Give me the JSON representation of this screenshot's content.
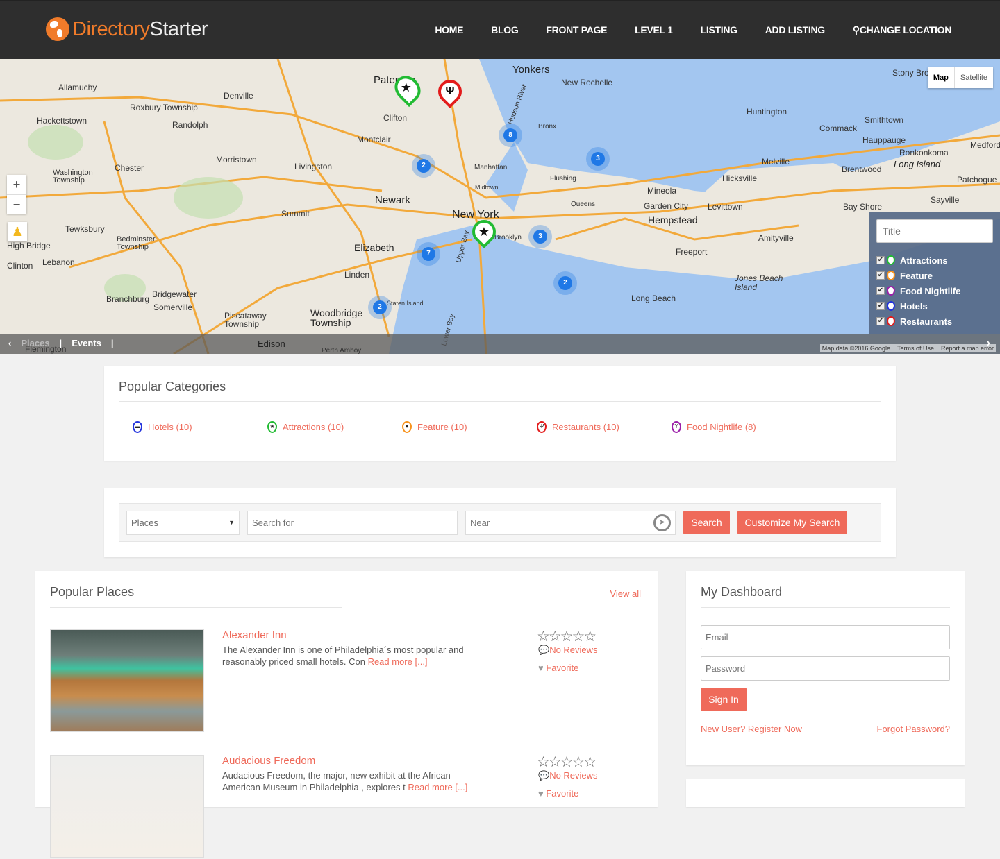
{
  "brand": {
    "name_a": "Directory",
    "name_b": "Starter"
  },
  "nav": [
    "HOME",
    "BLOG",
    "FRONT PAGE",
    "LEVEL 1",
    "LISTING",
    "ADD LISTING",
    "CHANGE LOCATION"
  ],
  "map": {
    "type_buttons": [
      "Map",
      "Satellite"
    ],
    "zoom_in": "+",
    "zoom_out": "−",
    "labels": [
      "Allamuchy",
      "Denville",
      "Paterson",
      "Yonkers",
      "New Rochelle",
      "Huntington",
      "Smithtown",
      "Stony Brook",
      "Clifton",
      "Hackettstown",
      "Roxbury Township",
      "Randolph",
      "Montclair",
      "Commack",
      "Hauppauge",
      "Ronkonkoma",
      "Medford",
      "Morristown",
      "Livingston",
      "Manhattan",
      "Bronx",
      "Melville",
      "Long Island",
      "Brentwood",
      "Patchogue",
      "Washington Township",
      "Chester",
      "Mineola",
      "Hicksville",
      "Newark",
      "Garden City",
      "Levittown",
      "Sayville",
      "Bay Shore",
      "New York",
      "Queens",
      "Flushing",
      "Hempstead",
      "Summit",
      "Tewksbury",
      "Bedminster Township",
      "Elizabeth",
      "Brooklyn",
      "Freeport",
      "Amityville",
      "High Bridge",
      "Clinton",
      "Lebanon",
      "Linden",
      "Jones Beach Island",
      "Bridgewater",
      "Branchburg",
      "Somerville",
      "Staten Island",
      "Long Beach",
      "Woodbridge Township",
      "Piscataway Township",
      "Edison",
      "Flemington",
      "Perth Amboy",
      "Upper Bay",
      "Lower Bay",
      "Hudson River",
      "Midtown"
    ],
    "clusters": [
      8,
      3,
      2,
      3,
      7,
      2,
      2
    ],
    "filter": {
      "placeholder": "Title",
      "items": [
        "Attractions",
        "Feature",
        "Food Nightlife",
        "Hotels",
        "Restaurants"
      ]
    },
    "tabs": [
      "Places",
      "Events"
    ],
    "credits": [
      "Map data ©2016 Google",
      "Terms of Use",
      "Report a map error"
    ]
  },
  "colors": {
    "accent": "#ef6a5a",
    "hotels": "#2233dd",
    "attractions": "#22bb33",
    "feature": "#f7931e",
    "restaurants": "#e31b1b",
    "food_nightlife": "#9b1fa8"
  },
  "categories": {
    "title": "Popular Categories",
    "items": [
      {
        "label": "Hotels (10)",
        "icon": "bed-icon"
      },
      {
        "label": "Attractions (10)",
        "icon": "star-icon"
      },
      {
        "label": "Feature (10)",
        "icon": "heart-icon"
      },
      {
        "label": "Restaurants (10)",
        "icon": "fork-knife-icon"
      },
      {
        "label": "Food Nightlife (8)",
        "icon": "cocktail-icon"
      }
    ]
  },
  "search": {
    "select_value": "Places",
    "search_placeholder": "Search for",
    "near_placeholder": "Near",
    "search_button": "Search",
    "customize_button": "Customize My Search"
  },
  "popular": {
    "title": "Popular Places",
    "view_all": "View all",
    "items": [
      {
        "title": "Alexander Inn",
        "desc": "The Alexander Inn is one of Philadelphia´s most popular and reasonably priced small hotels. Con ",
        "read_more": "Read more [...]",
        "reviews": "No Reviews",
        "favorite": "Favorite",
        "rating": 0
      },
      {
        "title": "Audacious Freedom",
        "desc": "Audacious Freedom, the major, new exhibit at the African American Museum in Philadelphia , explores t ",
        "read_more": "Read more [...]",
        "reviews": "No Reviews",
        "favorite": "Favorite",
        "rating": 0
      }
    ]
  },
  "dashboard": {
    "title": "My Dashboard",
    "email_placeholder": "Email",
    "password_placeholder": "Password",
    "signin": "Sign In",
    "register": "New User? Register Now",
    "forgot": "Forgot Password?"
  }
}
